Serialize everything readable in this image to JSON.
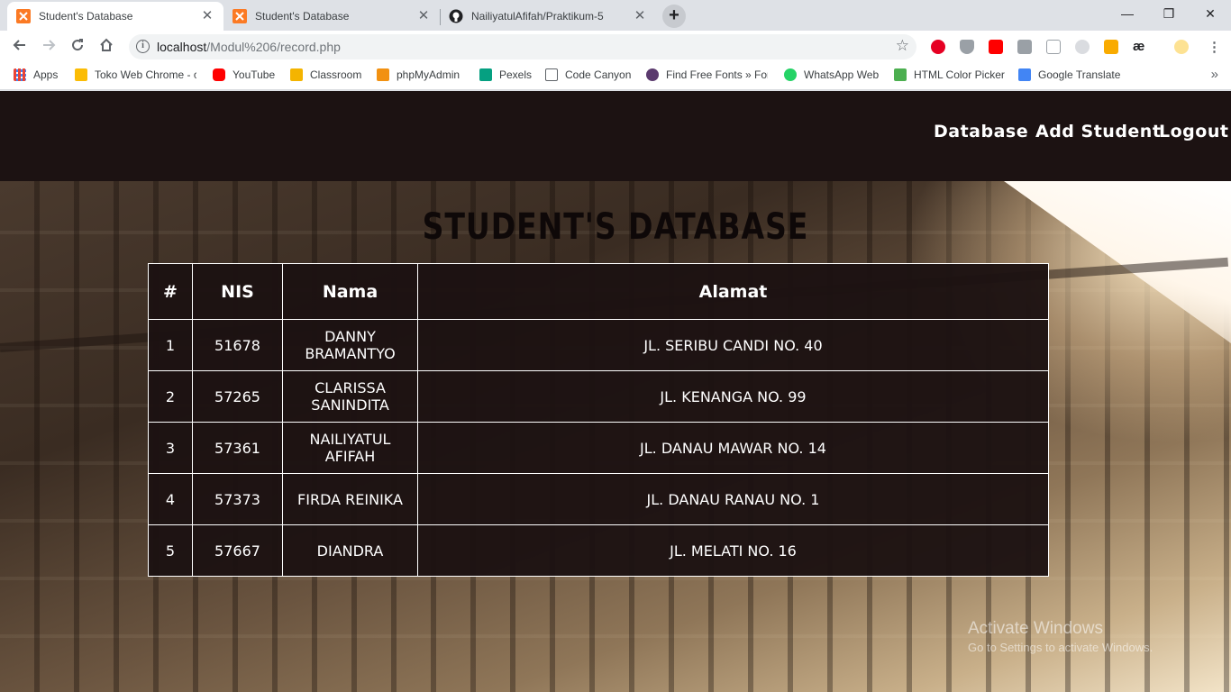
{
  "browser": {
    "tabs": [
      {
        "title": "Student's Database",
        "active": true,
        "icon": "xampp-icon"
      },
      {
        "title": "Student's Database",
        "active": false,
        "icon": "xampp-icon"
      },
      {
        "title": "NailiyatulAfifah/Praktikum-5",
        "active": false,
        "icon": "github-icon"
      }
    ],
    "close_glyph": "✕",
    "new_tab_glyph": "+",
    "window": {
      "minimize": "—",
      "maximize": "❐",
      "close": "✕"
    },
    "url_host": "localhost",
    "url_path": "/Modul%206/record.php",
    "bookmarks": [
      {
        "label": "Apps",
        "icon": "apps-grid-icon",
        "color": "#ea4335"
      },
      {
        "label": "Toko Web Chrome - c",
        "icon": "chrome-store-icon",
        "color": "#fbbc05"
      },
      {
        "label": "YouTube",
        "icon": "youtube-icon",
        "color": "#ff0000"
      },
      {
        "label": "Classroom",
        "icon": "classroom-icon",
        "color": "#f4b400"
      },
      {
        "label": "phpMyAdmin",
        "icon": "phpmyadmin-icon",
        "color": "#f29111"
      },
      {
        "label": "Pexels",
        "icon": "pexels-icon",
        "color": "#05a081"
      },
      {
        "label": "Code Canyon",
        "icon": "page-icon",
        "color": "#ffffff"
      },
      {
        "label": "Find Free Fonts » For",
        "icon": "fonts-icon",
        "color": "#5b3a6e"
      },
      {
        "label": "WhatsApp Web",
        "icon": "whatsapp-icon",
        "color": "#25d366"
      },
      {
        "label": "HTML Color Picker",
        "icon": "w3-icon",
        "color": "#4caf50"
      },
      {
        "label": "Google Translate",
        "icon": "translate-icon",
        "color": "#4285f4"
      }
    ],
    "bookmarks_more": "»"
  },
  "site": {
    "nav": {
      "database": "Database",
      "add_student": "Add Student",
      "logout": "Logout"
    },
    "title": "STUDENT'S DATABASE",
    "table": {
      "headers": [
        "#",
        "NIS",
        "Nama",
        "Alamat"
      ],
      "rows": [
        [
          "1",
          "51678",
          "Danny Bramantyo",
          "Jl. Seribu Candi No. 40"
        ],
        [
          "2",
          "57265",
          "Clarissa Sanindita",
          "Jl. Kenanga No. 99"
        ],
        [
          "3",
          "57361",
          "Nailiyatul Afifah",
          "Jl. Danau Mawar No. 14"
        ],
        [
          "4",
          "57373",
          "Firda Reinika",
          "Jl. Danau Ranau No. 1"
        ],
        [
          "5",
          "57667",
          "Diandra",
          "Jl. Melati No. 16"
        ]
      ]
    },
    "header_color": "#1c1212"
  },
  "watermark": {
    "line1": "Activate Windows",
    "line2": "Go to Settings to activate Windows."
  }
}
